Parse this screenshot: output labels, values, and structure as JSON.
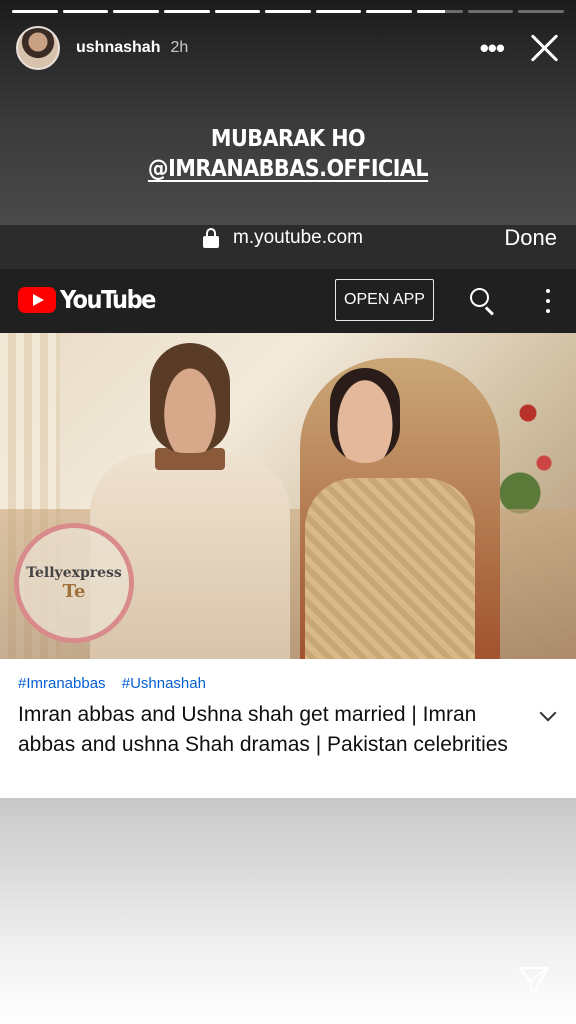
{
  "story": {
    "progress_segments": 11,
    "active_segment": 8,
    "active_segment_fill": 0.6,
    "username": "ushnashah",
    "time": "2h",
    "more_label": "•••",
    "caption_line1": "MUBARAK HO",
    "caption_mention": "@IMRANABBAS.OFFICIAL"
  },
  "browser": {
    "url": "m.youtube.com",
    "done_label": "Done"
  },
  "youtube": {
    "logo_text": "YouTube",
    "open_app_label": "OPEN APP",
    "watermark_text": "Tellyexpress",
    "watermark_mark": "Te",
    "tags": [
      "#Imranabbas",
      "#Ushnashah"
    ],
    "video_title": "Imran abbas and Ushna shah get married | Imran abbas and ushna Shah dramas | Pakistan celebrities"
  },
  "colors": {
    "youtube_red": "#ff0000",
    "link_blue": "#065fd4",
    "header_dark": "#202020"
  }
}
